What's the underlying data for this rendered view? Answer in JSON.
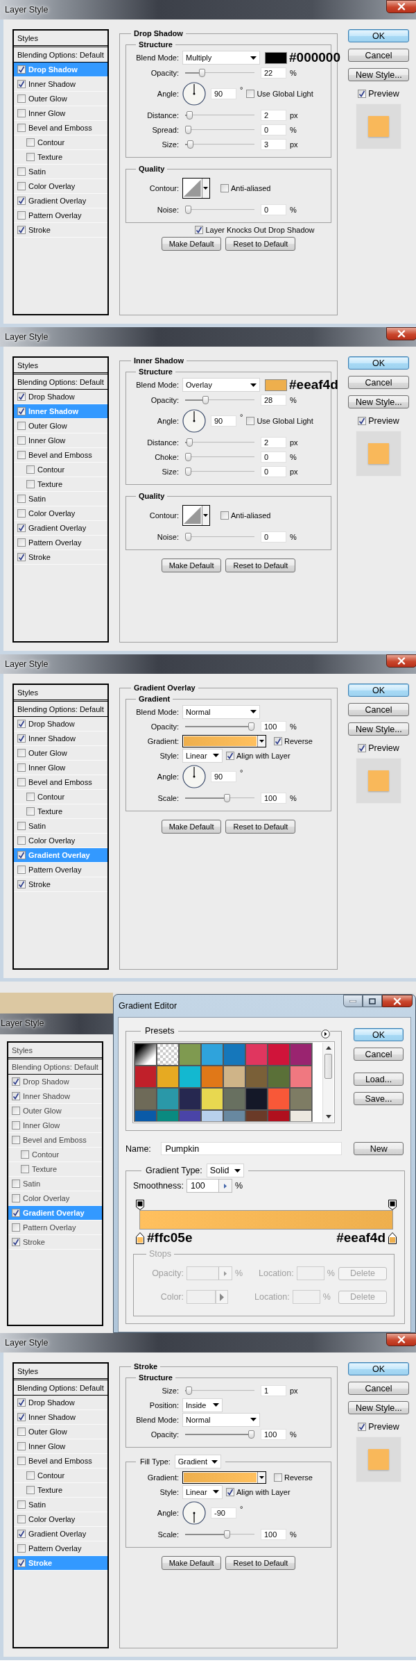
{
  "panels": [
    {
      "kind": "layer_style",
      "title": "Layer Style",
      "styles_header": "Styles",
      "blending": "Blending Options: Default",
      "effects": [
        {
          "label": "Drop Shadow",
          "checked": true,
          "selected": true
        },
        {
          "label": "Inner Shadow",
          "checked": true,
          "selected": false
        },
        {
          "label": "Outer Glow",
          "checked": false,
          "selected": false
        },
        {
          "label": "Inner Glow",
          "checked": false,
          "selected": false
        },
        {
          "label": "Bevel and Emboss",
          "checked": false,
          "selected": false,
          "children": [
            {
              "label": "Contour",
              "checked": false,
              "selected": false
            },
            {
              "label": "Texture",
              "checked": false,
              "selected": false
            }
          ]
        },
        {
          "label": "Satin",
          "checked": false,
          "selected": false
        },
        {
          "label": "Color Overlay",
          "checked": false,
          "selected": false
        },
        {
          "label": "Gradient Overlay",
          "checked": true,
          "selected": false
        },
        {
          "label": "Pattern Overlay",
          "checked": false,
          "selected": false
        },
        {
          "label": "Stroke",
          "checked": true,
          "selected": false
        }
      ],
      "section": {
        "title": "Drop Shadow",
        "groups": [
          {
            "title": "Structure",
            "rows": [
              {
                "kind": "blend",
                "label": "Blend Mode:",
                "value": "Multiply",
                "color": "#000000",
                "annotation": "#000000"
              },
              {
                "kind": "slider",
                "label": "Opacity:",
                "level": 0.22,
                "value": "22",
                "unit": "%"
              },
              {
                "kind": "angle",
                "label": "Angle:",
                "value": "90",
                "unit": "°",
                "check": {
                  "label": "Use Global Light",
                  "checked": false
                }
              },
              {
                "kind": "slider",
                "label": "Distance:",
                "level": 0.02,
                "value": "2",
                "unit": "px"
              },
              {
                "kind": "slider",
                "label": "Spread:",
                "level": 0,
                "value": "0",
                "unit": "%"
              },
              {
                "kind": "slider",
                "label": "Size:",
                "level": 0.03,
                "value": "3",
                "unit": "px"
              }
            ]
          },
          {
            "title": "Quality",
            "rows": [
              {
                "kind": "contour",
                "label": "Contour:",
                "check": {
                  "label": "Anti-aliased",
                  "checked": false
                }
              },
              {
                "kind": "slider",
                "label": "Noise:",
                "level": 0,
                "value": "0",
                "unit": "%"
              }
            ]
          }
        ],
        "options": [
          {
            "label": "Layer Knocks Out Drop Shadow",
            "checked": true
          }
        ],
        "buttons": [
          "Make Default",
          "Reset to Default"
        ]
      },
      "buttons": [
        {
          "label": "OK",
          "default": true
        },
        {
          "label": "Cancel",
          "default": false
        },
        {
          "label": "New Style...",
          "default": false
        }
      ],
      "preview": {
        "label": "Preview",
        "checked": true
      }
    },
    {
      "kind": "layer_style",
      "title": "Layer Style",
      "styles_header": "Styles",
      "blending": "Blending Options: Default",
      "effects": [
        {
          "label": "Drop Shadow",
          "checked": true,
          "selected": false
        },
        {
          "label": "Inner Shadow",
          "checked": true,
          "selected": true
        },
        {
          "label": "Outer Glow",
          "checked": false,
          "selected": false
        },
        {
          "label": "Inner Glow",
          "checked": false,
          "selected": false
        },
        {
          "label": "Bevel and Emboss",
          "checked": false,
          "selected": false,
          "children": [
            {
              "label": "Contour",
              "checked": false,
              "selected": false
            },
            {
              "label": "Texture",
              "checked": false,
              "selected": false
            }
          ]
        },
        {
          "label": "Satin",
          "checked": false,
          "selected": false
        },
        {
          "label": "Color Overlay",
          "checked": false,
          "selected": false
        },
        {
          "label": "Gradient Overlay",
          "checked": true,
          "selected": false
        },
        {
          "label": "Pattern Overlay",
          "checked": false,
          "selected": false
        },
        {
          "label": "Stroke",
          "checked": true,
          "selected": false
        }
      ],
      "section": {
        "title": "Inner Shadow",
        "groups": [
          {
            "title": "Structure",
            "rows": [
              {
                "kind": "blend",
                "label": "Blend Mode:",
                "value": "Overlay",
                "color": "#eeaf4d",
                "annotation": "#eeaf4d"
              },
              {
                "kind": "slider",
                "label": "Opacity:",
                "level": 0.28,
                "value": "28",
                "unit": "%"
              },
              {
                "kind": "angle",
                "label": "Angle:",
                "value": "90",
                "unit": "°",
                "check": {
                  "label": "Use Global Light",
                  "checked": false
                }
              },
              {
                "kind": "slider",
                "label": "Distance:",
                "level": 0.02,
                "value": "2",
                "unit": "px"
              },
              {
                "kind": "slider",
                "label": "Choke:",
                "level": 0,
                "value": "0",
                "unit": "%"
              },
              {
                "kind": "slider",
                "label": "Size:",
                "level": 0,
                "value": "0",
                "unit": "px"
              }
            ]
          },
          {
            "title": "Quality",
            "rows": [
              {
                "kind": "contour",
                "label": "Contour:",
                "check": {
                  "label": "Anti-aliased",
                  "checked": false
                }
              },
              {
                "kind": "slider",
                "label": "Noise:",
                "level": 0,
                "value": "0",
                "unit": "%"
              }
            ]
          }
        ],
        "buttons": [
          "Make Default",
          "Reset to Default"
        ]
      },
      "buttons": [
        {
          "label": "OK",
          "default": true
        },
        {
          "label": "Cancel",
          "default": false
        },
        {
          "label": "New Style...",
          "default": false
        }
      ],
      "preview": {
        "label": "Preview",
        "checked": true
      }
    },
    {
      "kind": "layer_style",
      "title": "Layer Style",
      "styles_header": "Styles",
      "blending": "Blending Options: Default",
      "effects": [
        {
          "label": "Drop Shadow",
          "checked": true,
          "selected": false
        },
        {
          "label": "Inner Shadow",
          "checked": true,
          "selected": false
        },
        {
          "label": "Outer Glow",
          "checked": false,
          "selected": false
        },
        {
          "label": "Inner Glow",
          "checked": false,
          "selected": false
        },
        {
          "label": "Bevel and Emboss",
          "checked": false,
          "selected": false,
          "children": [
            {
              "label": "Contour",
              "checked": false,
              "selected": false
            },
            {
              "label": "Texture",
              "checked": false,
              "selected": false
            }
          ]
        },
        {
          "label": "Satin",
          "checked": false,
          "selected": false
        },
        {
          "label": "Color Overlay",
          "checked": false,
          "selected": false
        },
        {
          "label": "Gradient Overlay",
          "checked": true,
          "selected": true
        },
        {
          "label": "Pattern Overlay",
          "checked": false,
          "selected": false
        },
        {
          "label": "Stroke",
          "checked": true,
          "selected": false
        }
      ],
      "section": {
        "title": "Gradient Overlay",
        "groups": [
          {
            "title": "Gradient",
            "rows": [
              {
                "kind": "blend",
                "label": "Blend Mode:",
                "value": "Normal"
              },
              {
                "kind": "slider",
                "label": "Opacity:",
                "level": 1,
                "value": "100",
                "unit": "%"
              },
              {
                "kind": "gradient",
                "label": "Gradient:",
                "check": {
                  "label": "Reverse",
                  "checked": true
                }
              },
              {
                "kind": "select",
                "label": "Style:",
                "value": "Linear",
                "check": {
                  "label": "Align with Layer",
                  "checked": true
                }
              },
              {
                "kind": "angle",
                "label": "Angle:",
                "value": "90",
                "unit": "°"
              },
              {
                "kind": "slider",
                "label": "Scale:",
                "level": 0.62,
                "value": "100",
                "unit": "%"
              }
            ]
          }
        ],
        "buttons": [
          "Make Default",
          "Reset to Default"
        ]
      },
      "buttons": [
        {
          "label": "OK",
          "default": true
        },
        {
          "label": "Cancel",
          "default": false
        },
        {
          "label": "New Style...",
          "default": false
        }
      ],
      "preview": {
        "label": "Preview",
        "checked": true
      }
    },
    {
      "kind": "gradient_editor",
      "background": {
        "title": "Layer Style",
        "styles_header": "Styles",
        "blending": "Blending Options: Default",
        "effects": [
          {
            "label": "Drop Shadow",
            "checked": true,
            "selected": false
          },
          {
            "label": "Inner Shadow",
            "checked": true,
            "selected": false
          },
          {
            "label": "Outer Glow",
            "checked": false,
            "selected": false
          },
          {
            "label": "Inner Glow",
            "checked": false,
            "selected": false
          },
          {
            "label": "Bevel and Emboss",
            "checked": false,
            "selected": false,
            "children": [
              {
                "label": "Contour",
                "checked": false,
                "selected": false
              },
              {
                "label": "Texture",
                "checked": false,
                "selected": false
              }
            ]
          },
          {
            "label": "Satin",
            "checked": false,
            "selected": false
          },
          {
            "label": "Color Overlay",
            "checked": false,
            "selected": false
          },
          {
            "label": "Gradient Overlay",
            "checked": true,
            "selected": true
          },
          {
            "label": "Pattern Overlay",
            "checked": false,
            "selected": false
          },
          {
            "label": "Stroke",
            "checked": true,
            "selected": false
          }
        ]
      },
      "title": "Gradient Editor",
      "presets": {
        "title": "Presets",
        "swatches": [
          {
            "kind": "gradient"
          },
          {
            "kind": "transparent"
          },
          {
            "kind": "solid",
            "color": "#7f9a50"
          },
          {
            "kind": "solid",
            "color": "#2fa3dc"
          },
          {
            "kind": "solid",
            "color": "#1577bb"
          },
          {
            "kind": "solid",
            "color": "#e0365f"
          },
          {
            "kind": "solid",
            "color": "#d0143a"
          },
          {
            "kind": "solid",
            "color": "#9a2470"
          },
          {
            "kind": "solid",
            "color": "#c0202a"
          },
          {
            "kind": "solid",
            "color": "#e6aa22"
          },
          {
            "kind": "solid",
            "color": "#13b8d0"
          },
          {
            "kind": "solid",
            "color": "#e07818"
          },
          {
            "kind": "solid",
            "color": "#cfb488"
          },
          {
            "kind": "solid",
            "color": "#7a6038"
          },
          {
            "kind": "solid",
            "color": "#5a7038"
          },
          {
            "kind": "solid",
            "color": "#f07880"
          },
          {
            "kind": "solid",
            "color": "#6e6a58"
          },
          {
            "kind": "solid",
            "color": "#2a98a8"
          },
          {
            "kind": "solid",
            "color": "#262850"
          },
          {
            "kind": "solid",
            "color": "#e8d850"
          },
          {
            "kind": "solid",
            "color": "#687060"
          },
          {
            "kind": "solid",
            "color": "#141828"
          },
          {
            "kind": "solid",
            "color": "#f85838"
          },
          {
            "kind": "solid",
            "color": "#7e7c64"
          },
          {
            "kind": "solid",
            "color": "#0a5aa8"
          },
          {
            "kind": "solid",
            "color": "#0a8a80"
          },
          {
            "kind": "solid",
            "color": "#4a44a8"
          },
          {
            "kind": "solid",
            "color": "#b8d0ec"
          },
          {
            "kind": "solid",
            "color": "#6888a0"
          },
          {
            "kind": "solid",
            "color": "#6a3a28"
          },
          {
            "kind": "solid",
            "color": "#b0101e"
          },
          {
            "kind": "solid",
            "color": "#ece8e0"
          }
        ]
      },
      "buttons": [
        {
          "label": "OK",
          "default": true
        },
        {
          "label": "Cancel",
          "default": false
        },
        {
          "label": "Load...",
          "default": false
        },
        {
          "label": "Save...",
          "default": false
        }
      ],
      "name": {
        "label": "Name:",
        "value": "Pumpkin"
      },
      "new_button": "New",
      "gradient_type": {
        "label": "Gradient Type:",
        "value": "Solid"
      },
      "smoothness": {
        "label": "Smoothness:",
        "value": "100",
        "unit": "%"
      },
      "color_stops": [
        {
          "color": "#ffc05e",
          "annotation": "#ffc05e"
        },
        {
          "color": "#eeaf4d",
          "annotation": "#eeaf4d"
        }
      ],
      "stops": {
        "title": "Stops",
        "disabled": true,
        "rows": [
          {
            "kind": "opacity",
            "label": "Opacity:",
            "unit": "%",
            "location_label": "Location:",
            "location_unit": "%",
            "button": "Delete"
          },
          {
            "kind": "color",
            "label": "Color:",
            "location_label": "Location:",
            "location_unit": "%",
            "button": "Delete"
          }
        ]
      }
    },
    {
      "kind": "layer_style",
      "title": "Layer Style",
      "styles_header": "Styles",
      "blending": "Blending Options: Default",
      "effects": [
        {
          "label": "Drop Shadow",
          "checked": true,
          "selected": false
        },
        {
          "label": "Inner Shadow",
          "checked": true,
          "selected": false
        },
        {
          "label": "Outer Glow",
          "checked": false,
          "selected": false
        },
        {
          "label": "Inner Glow",
          "checked": false,
          "selected": false
        },
        {
          "label": "Bevel and Emboss",
          "checked": false,
          "selected": false,
          "children": [
            {
              "label": "Contour",
              "checked": false,
              "selected": false
            },
            {
              "label": "Texture",
              "checked": false,
              "selected": false
            }
          ]
        },
        {
          "label": "Satin",
          "checked": false,
          "selected": false
        },
        {
          "label": "Color Overlay",
          "checked": false,
          "selected": false
        },
        {
          "label": "Gradient Overlay",
          "checked": true,
          "selected": false
        },
        {
          "label": "Pattern Overlay",
          "checked": false,
          "selected": false
        },
        {
          "label": "Stroke",
          "checked": true,
          "selected": true
        }
      ],
      "section": {
        "title": "Stroke",
        "groups": [
          {
            "title": "Structure",
            "rows": [
              {
                "kind": "slider",
                "label": "Size:",
                "level": 0.01,
                "value": "1",
                "unit": "px"
              },
              {
                "kind": "select",
                "label": "Position:",
                "value": "Inside"
              },
              {
                "kind": "blend",
                "label": "Blend Mode:",
                "value": "Normal"
              },
              {
                "kind": "slider",
                "label": "Opacity:",
                "level": 1,
                "value": "100",
                "unit": "%"
              }
            ]
          },
          {
            "legend": {
              "label": "Fill Type:",
              "value": "Gradient"
            },
            "rows": [
              {
                "kind": "gradient",
                "label": "Gradient:",
                "check": {
                  "label": "Reverse",
                  "checked": false
                }
              },
              {
                "kind": "select",
                "label": "Style:",
                "value": "Linear",
                "check": {
                  "label": "Align with Layer",
                  "checked": true
                }
              },
              {
                "kind": "angle",
                "label": "Angle:",
                "value": "-90",
                "unit": "°"
              },
              {
                "kind": "slider",
                "label": "Scale:",
                "level": 0.62,
                "value": "100",
                "unit": "%"
              }
            ]
          }
        ],
        "buttons": [
          "Make Default",
          "Reset to Default"
        ]
      },
      "buttons": [
        {
          "label": "OK",
          "default": true
        },
        {
          "label": "Cancel",
          "default": false
        },
        {
          "label": "New Style...",
          "default": false
        }
      ],
      "preview": {
        "label": "Preview",
        "checked": true
      }
    }
  ]
}
